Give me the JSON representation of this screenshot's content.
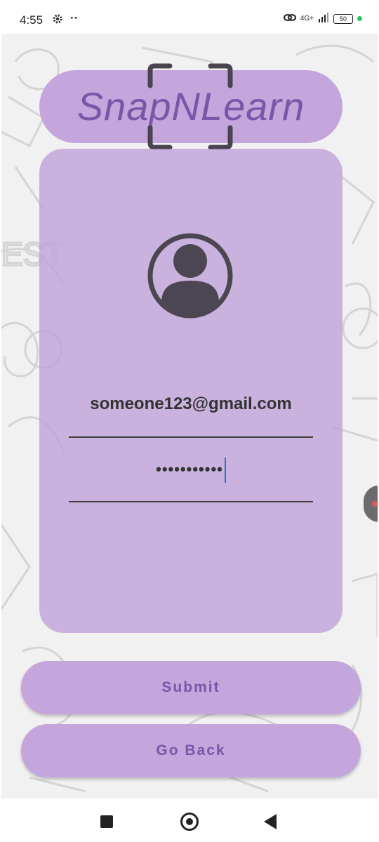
{
  "status_bar": {
    "time": "4:55",
    "dots": "··",
    "network": "4G+",
    "battery": "50"
  },
  "app": {
    "title": "SnapNLearn"
  },
  "login_form": {
    "email_value": "someone123@gmail.com",
    "password_value": "•••••••••••"
  },
  "buttons": {
    "submit_label": "Submit",
    "go_back_label": "Go Back"
  },
  "icons": {
    "settings": "gear-icon",
    "link": "link-icon",
    "signal": "signal-icon",
    "battery": "battery-icon",
    "avatar": "user-avatar-icon",
    "scan": "scan-frame-icon",
    "nav_recent": "square-icon",
    "nav_home": "circle-home-icon",
    "nav_back": "triangle-back-icon"
  },
  "colors": {
    "accent": "#c4a5dc",
    "accent_text": "#7a56a8",
    "card": "#bea0d7"
  }
}
